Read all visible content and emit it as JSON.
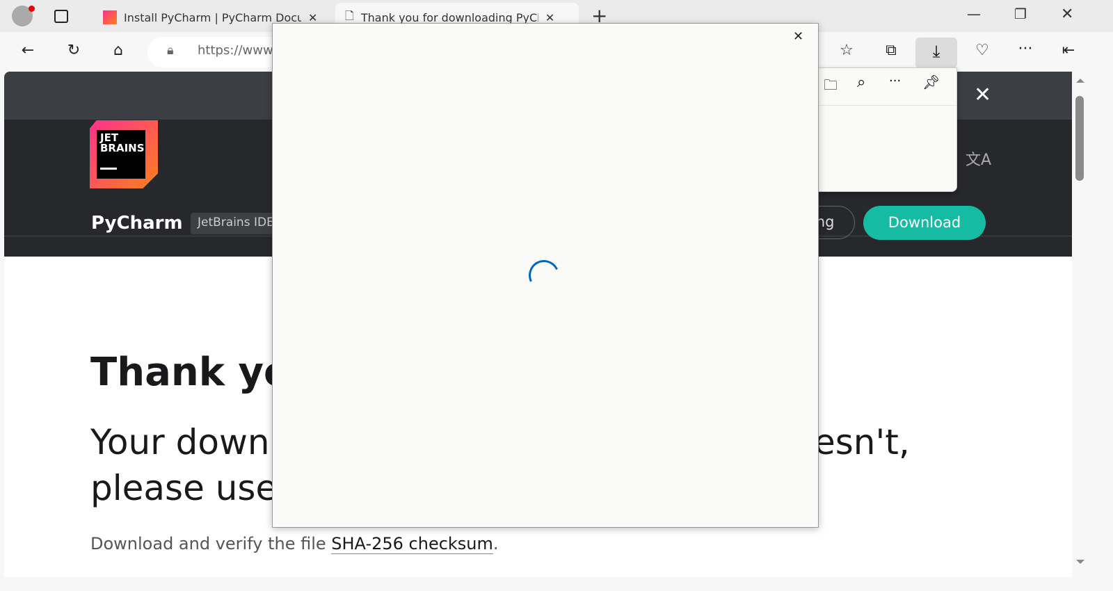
{
  "browser": {
    "tabs": [
      {
        "label": "Install PyCharm | PyCharm Documentation"
      },
      {
        "label": "Thank you for downloading PyCharm"
      }
    ],
    "url": "https://www.",
    "icons": [
      "profile-icon",
      "workspaces-icon",
      "back-icon",
      "refresh-icon",
      "home-icon",
      "lock-icon",
      "favorites-icon",
      "collections-icon",
      "downloads-icon",
      "browser-essentials-icon",
      "more-icon",
      "sidebar-icon"
    ]
  },
  "downloads_panel": {
    "icons": [
      "folder-icon",
      "search-icon",
      "more-icon",
      "pin-icon"
    ]
  },
  "site": {
    "logo_text": "JET BRAINS",
    "product": "PyCharm",
    "badge": "JetBrains IDE",
    "pricing_partial": "ing",
    "download": "Download",
    "heading": "Thank you",
    "body_left_1": "Your down",
    "body_right_1": "esn't,",
    "body_left_2": "please use",
    "verify_text": "Download and verify the file ",
    "checksum_link": "SHA-256 checksum",
    "period": "."
  },
  "colors": {
    "accent": "#16bba4",
    "spinner": "#0067c0"
  }
}
